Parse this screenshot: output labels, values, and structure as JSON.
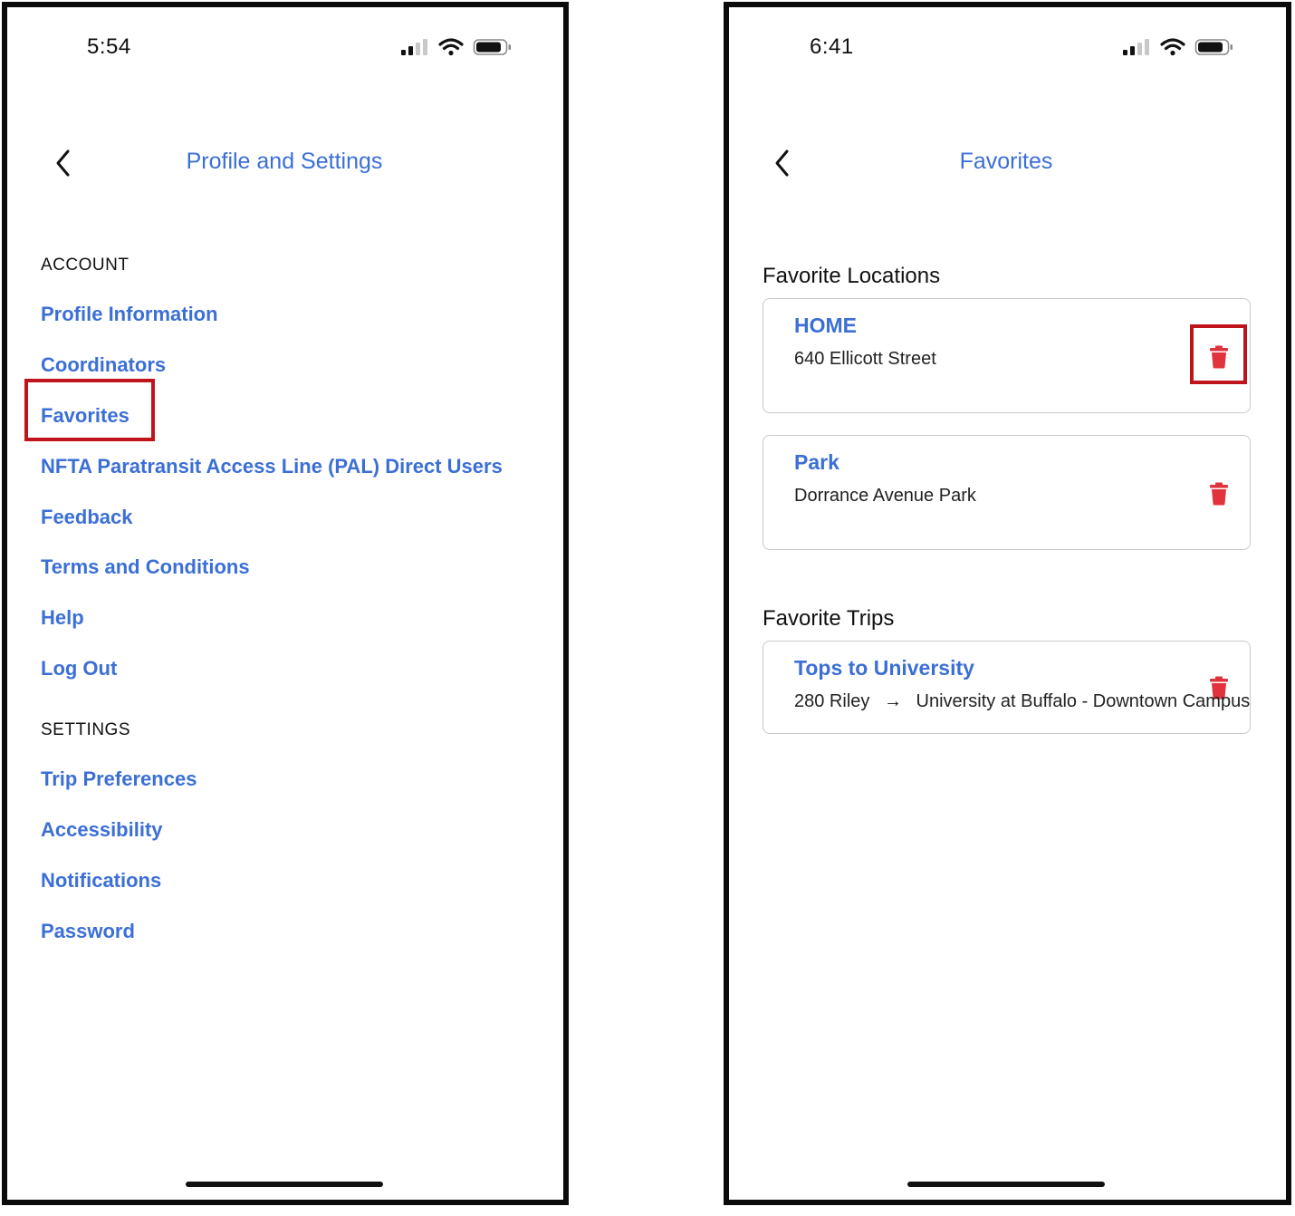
{
  "left_screen": {
    "status": {
      "time": "5:54"
    },
    "header": {
      "title": "Profile and Settings"
    },
    "account": {
      "label": "ACCOUNT",
      "items": [
        {
          "label": "Profile Information"
        },
        {
          "label": "Coordinators"
        },
        {
          "label": "Favorites"
        },
        {
          "label": "NFTA Paratransit Access Line (PAL) Direct Users"
        },
        {
          "label": "Feedback"
        },
        {
          "label": "Terms and Conditions"
        },
        {
          "label": "Help"
        },
        {
          "label": "Log Out"
        }
      ]
    },
    "settings": {
      "label": "SETTINGS",
      "items": [
        {
          "label": "Trip Preferences"
        },
        {
          "label": "Accessibility"
        },
        {
          "label": "Notifications"
        },
        {
          "label": "Password"
        }
      ]
    }
  },
  "right_screen": {
    "status": {
      "time": "6:41"
    },
    "header": {
      "title": "Favorites"
    },
    "locations": {
      "heading": "Favorite Locations",
      "items": [
        {
          "name": "HOME",
          "address": "640 Ellicott Street"
        },
        {
          "name": "Park",
          "address": "Dorrance Avenue Park"
        }
      ]
    },
    "trips": {
      "heading": "Favorite Trips",
      "items": [
        {
          "name": "Tops to University",
          "from": "280 Riley",
          "to": "University at Buffalo - Downtown Campus"
        }
      ]
    }
  },
  "colors": {
    "accent": "#3b6fd6",
    "delete": "#e0333d",
    "highlight": "#c0141c"
  },
  "icons": {
    "back": "chevron-left-icon",
    "delete": "trash-icon",
    "signal": "cellular-signal-icon",
    "wifi": "wifi-icon",
    "battery": "battery-icon",
    "arrow": "arrow-right-icon"
  }
}
